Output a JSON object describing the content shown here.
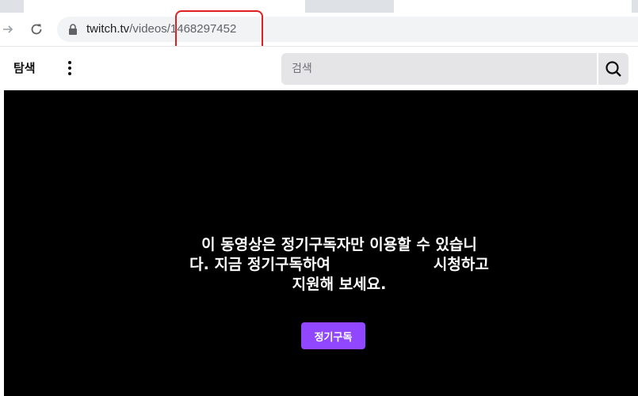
{
  "browser": {
    "url_host": "twitch.tv",
    "url_path_prefix": "/videos/",
    "url_video_id": "1468297452"
  },
  "site_nav": {
    "browse_label": "탐색",
    "search_placeholder": "검색"
  },
  "player": {
    "gate_message_line1": "이 동영상은 정기구독자만 이용할 수 있습니",
    "gate_message_line2_start": "다. 지금 정기구독하여",
    "gate_message_line2_end": "시청하고",
    "gate_message_line3": "지원해 보세요.",
    "subscribe_label": "정기구독"
  },
  "colors": {
    "accent": "#9147ff",
    "highlight": "#e02020",
    "player_bg": "#000000"
  }
}
